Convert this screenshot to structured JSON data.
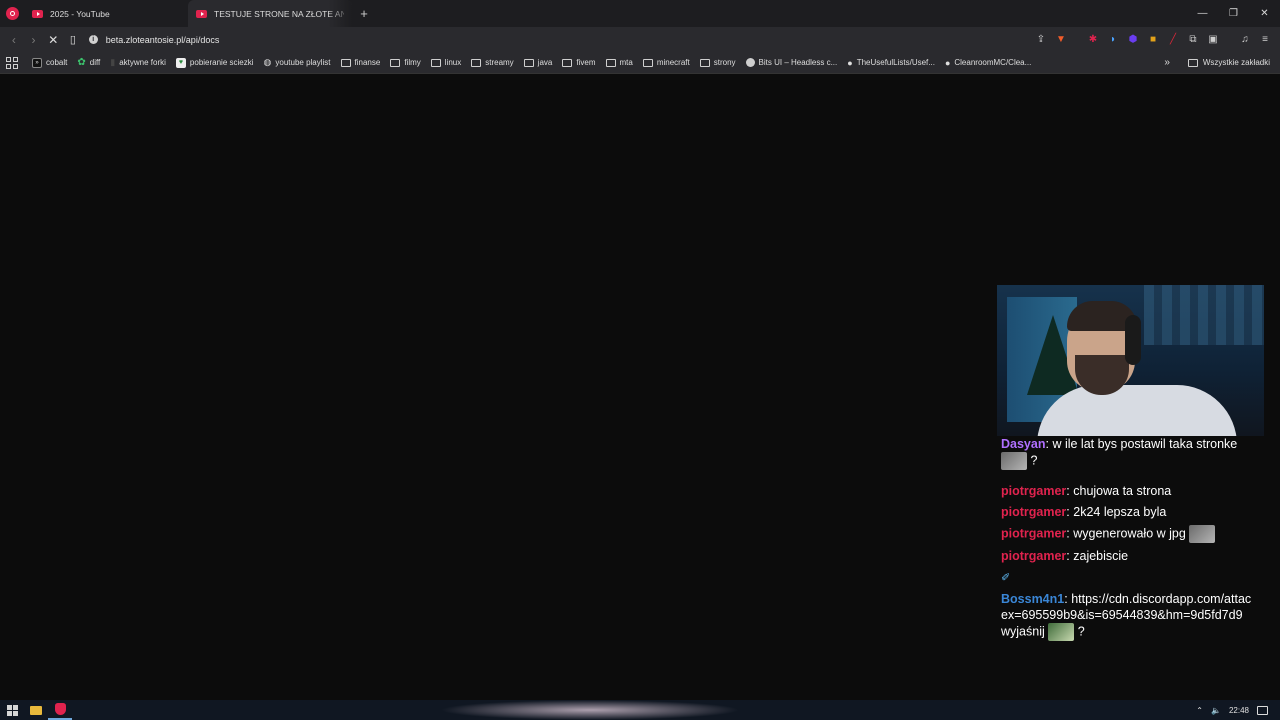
{
  "browser": {
    "tabs": [
      {
        "title": "2025 - YouTube",
        "active": false
      },
      {
        "title": "TESTUJE STRONE NA ZŁOTE ANTOSIE",
        "active": true
      }
    ],
    "new_tab": "+",
    "window_controls": {
      "minimize": "—",
      "restore": "❐",
      "close": "✕"
    },
    "url": "beta.zloteantosie.pl/api/docs",
    "nav_icons": {
      "back": "chevron-left-icon",
      "forward": "chevron-right-icon",
      "stop": "close-icon",
      "bookmark": "bookmark-icon",
      "info": "info-icon"
    }
  },
  "bookmarks": {
    "items": [
      {
        "label": "cobalt",
        "icon": "cobalt-icon"
      },
      {
        "label": "diff",
        "icon": "diff-icon"
      },
      {
        "label": "aktywne forki",
        "icon": "page-icon"
      },
      {
        "label": "pobieranie sciezki",
        "icon": "page-icon"
      },
      {
        "label": "youtube playlist",
        "icon": "globe-icon"
      },
      {
        "label": "finanse",
        "icon": "folder-icon"
      },
      {
        "label": "filmy",
        "icon": "folder-icon"
      },
      {
        "label": "linux",
        "icon": "folder-icon"
      },
      {
        "label": "streamy",
        "icon": "folder-icon"
      },
      {
        "label": "java",
        "icon": "folder-icon"
      },
      {
        "label": "fivem",
        "icon": "folder-icon"
      },
      {
        "label": "mta",
        "icon": "folder-icon"
      },
      {
        "label": "minecraft",
        "icon": "folder-icon"
      },
      {
        "label": "strony",
        "icon": "folder-icon"
      },
      {
        "label": "Bits UI – Headless c...",
        "icon": "dot-icon"
      },
      {
        "label": "TheUsefulLists/Usef...",
        "icon": "github-icon"
      },
      {
        "label": "CleanroomMC/Clea...",
        "icon": "github-icon"
      }
    ],
    "overflow": "»",
    "all_bookmarks": "Wszystkie zakładki"
  },
  "chat": {
    "messages": [
      {
        "user": "Dasyan",
        "color": "#b070ff",
        "text": "w ile lat bys postawil taka stronke",
        "suffix": "?",
        "emote": true
      },
      {
        "user": "piotrgamer",
        "color": "#e0234e",
        "text": "chujowa ta strona"
      },
      {
        "user": "piotrgamer",
        "color": "#e0234e",
        "text": "2k24 lepsza byla"
      },
      {
        "user": "piotrgamer",
        "color": "#e0234e",
        "text": "wygenerowało w jpg",
        "emote": true
      },
      {
        "user": "piotrgamer",
        "color": "#e0234e",
        "text": "zajebiscie"
      },
      {
        "user": "Bossm4n1",
        "color": "#3a86d6",
        "text": "https://cdn.discordapp.com/attac",
        "line2": "ex=695599b9&is=69544839&hm=9d5fd7d9",
        "line3": "wyjaśnij",
        "suffix": "?"
      }
    ]
  },
  "taskbar": {
    "clock": "22:48",
    "tray_icons": [
      "chevron-up-icon",
      "volume-icon"
    ]
  }
}
